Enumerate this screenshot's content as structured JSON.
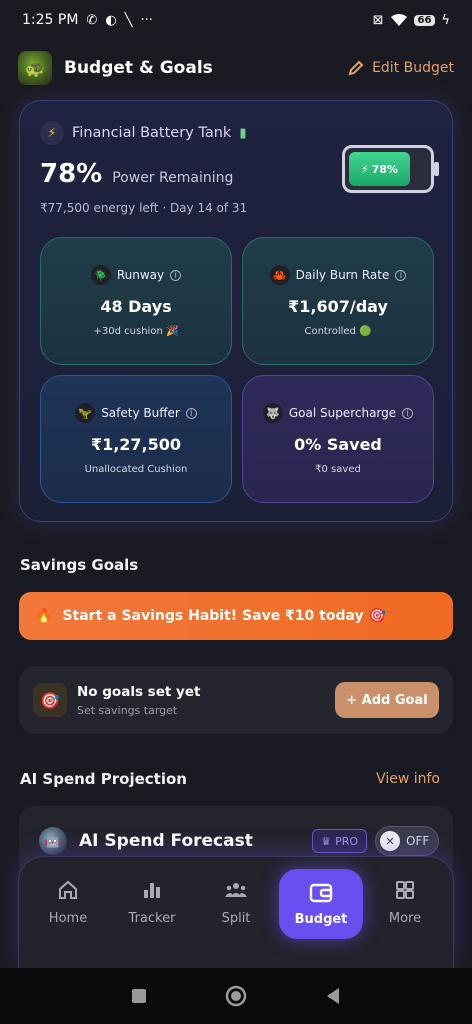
{
  "status_bar": {
    "time": "1:25 PM",
    "battery": "66"
  },
  "header": {
    "title": "Budget & Goals",
    "edit_label": "Edit Budget"
  },
  "battery_tank": {
    "title": "Financial Battery Tank",
    "percent": "78%",
    "percent_label": "Power Remaining",
    "subtitle": "₹77,500 energy left · Day 14 of 31",
    "widget_label": "78%",
    "level": 0.78,
    "tiles": [
      {
        "label": "Runway",
        "emoji": "🪲",
        "value": "48 Days",
        "note": "+30d cushion 🎉"
      },
      {
        "label": "Daily Burn Rate",
        "emoji": "🦀",
        "value": "₹1,607/day",
        "note": "Controlled 🟢"
      },
      {
        "label": "Safety Buffer",
        "emoji": "🦖",
        "value": "₹1,27,500",
        "note": "Unallocated Cushion"
      },
      {
        "label": "Goal Supercharge",
        "emoji": "🐺",
        "value": "0% Saved",
        "note": "₹0 saved"
      }
    ]
  },
  "savings": {
    "section_title": "Savings Goals",
    "banner": "Start a Savings Habit! Save ₹10 today 🎯",
    "empty_title": "No goals set yet",
    "empty_sub": "Set savings target",
    "add_goal": "+ Add Goal"
  },
  "ai": {
    "section_title": "AI Spend Projection",
    "view_info": "View info",
    "card_title": "AI Spend Forecast",
    "pro_badge": "PRO",
    "toggle_label": "OFF"
  },
  "nav": {
    "items": [
      "Home",
      "Tracker",
      "Split",
      "Budget",
      "More"
    ],
    "active": "Budget"
  },
  "colors": {
    "accent": "#6a4ff0",
    "orange": "#ef6a22",
    "edit": "#e0a06a",
    "battery_green": "#1ea86a"
  }
}
